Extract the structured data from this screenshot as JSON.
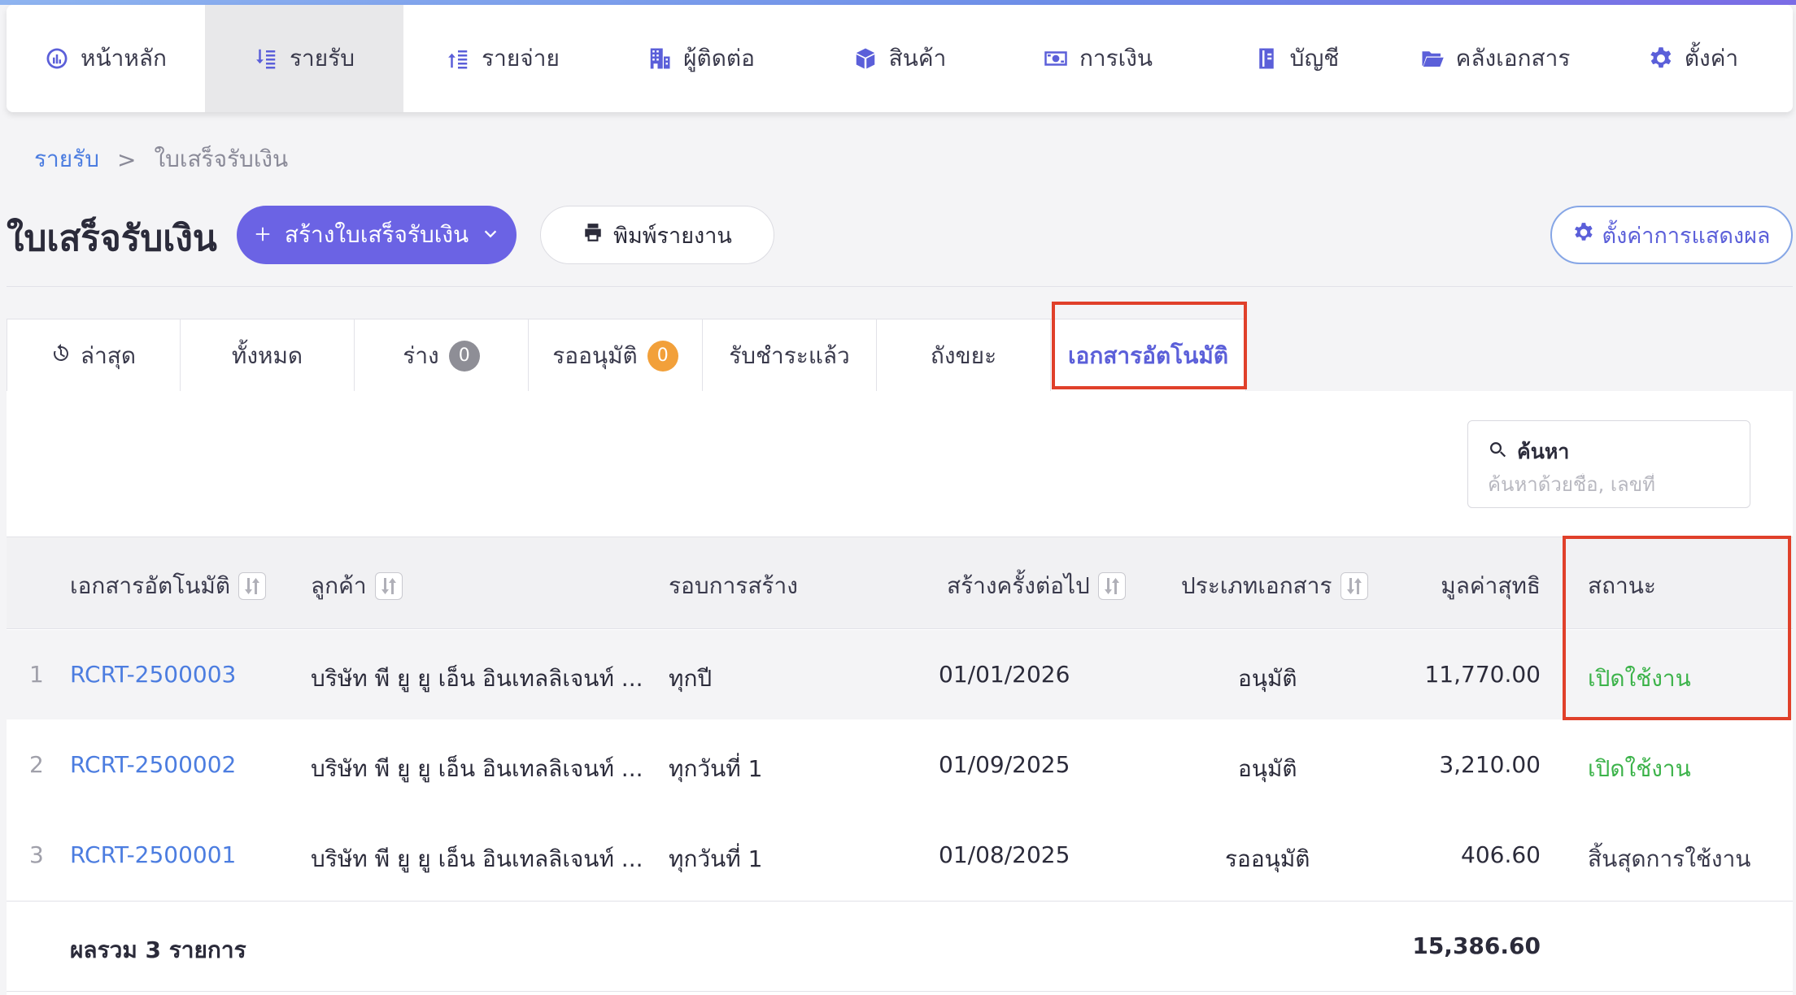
{
  "nav": {
    "items": [
      {
        "label": "หน้าหลัก",
        "icon": "dashboard-icon"
      },
      {
        "label": "รายรับ",
        "icon": "income-icon",
        "active": true
      },
      {
        "label": "รายจ่าย",
        "icon": "expense-icon"
      },
      {
        "label": "ผู้ติดต่อ",
        "icon": "building-icon"
      },
      {
        "label": "สินค้า",
        "icon": "box-icon"
      },
      {
        "label": "การเงิน",
        "icon": "money-icon"
      },
      {
        "label": "บัญชี",
        "icon": "book-icon"
      },
      {
        "label": "คลังเอกสาร",
        "icon": "folder-icon"
      },
      {
        "label": "ตั้งค่า",
        "icon": "gear-icon"
      }
    ]
  },
  "breadcrumb": {
    "parent": "รายรับ",
    "separator": ">",
    "current": "ใบเสร็จรับเงิน"
  },
  "page": {
    "title": "ใบเสร็จรับเงิน",
    "create_label": "สร้างใบเสร็จรับเงิน",
    "print_label": "พิมพ์รายงาน",
    "display_settings_label": "ตั้งค่าการแสดงผล"
  },
  "tabs": [
    {
      "label": "ล่าสุด",
      "icon": "history-icon"
    },
    {
      "label": "ทั้งหมด"
    },
    {
      "label": "ร่าง",
      "badge": "0",
      "badge_color": "#8e8e96"
    },
    {
      "label": "รออนุมัติ",
      "badge": "0",
      "badge_color": "#f2a03a"
    },
    {
      "label": "รับชำระแล้ว"
    },
    {
      "label": "ถังขยะ"
    },
    {
      "label": "เอกสารอัตโนมัติ",
      "active": true
    }
  ],
  "search": {
    "label": "ค้นหา",
    "placeholder": "ค้นหาด้วยชื่อ, เลขที่"
  },
  "table": {
    "headers": {
      "doc": "เอกสารอัตโนมัติ",
      "customer": "ลูกค้า",
      "cycle": "รอบการสร้าง",
      "next": "สร้างครั้งต่อไป",
      "type": "ประเภทเอกสาร",
      "amount": "มูลค่าสุทธิ",
      "status": "สถานะ"
    },
    "rows": [
      {
        "num": "1",
        "doc": "RCRT-2500003",
        "customer": "บริษัท พี ยู ยู เอ็น อินเทลลิเจนท์ ...",
        "cycle": "ทุกปี",
        "next": "01/01/2026",
        "type": "อนุมัติ",
        "amount": "11,770.00",
        "status": "เปิดใช้งาน",
        "active": true
      },
      {
        "num": "2",
        "doc": "RCRT-2500002",
        "customer": "บริษัท พี ยู ยู เอ็น อินเทลลิเจนท์ ...",
        "cycle": "ทุกวันที่ 1",
        "next": "01/09/2025",
        "type": "อนุมัติ",
        "amount": "3,210.00",
        "status": "เปิดใช้งาน",
        "active": true
      },
      {
        "num": "3",
        "doc": "RCRT-2500001",
        "customer": "บริษัท พี ยู ยู เอ็น อินเทลลิเจนท์ ...",
        "cycle": "ทุกวันที่ 1",
        "next": "01/08/2025",
        "type": "รออนุมัติ",
        "amount": "406.60",
        "status": "สิ้นสุดการใช้งาน",
        "active": false
      }
    ],
    "total_label": "ผลรวม 3 รายการ",
    "total_amount": "15,386.60"
  },
  "colors": {
    "accent": "#6b63e4",
    "link": "#4c7de0",
    "status_active": "#3cb34a",
    "highlight_box": "#e0402a"
  }
}
